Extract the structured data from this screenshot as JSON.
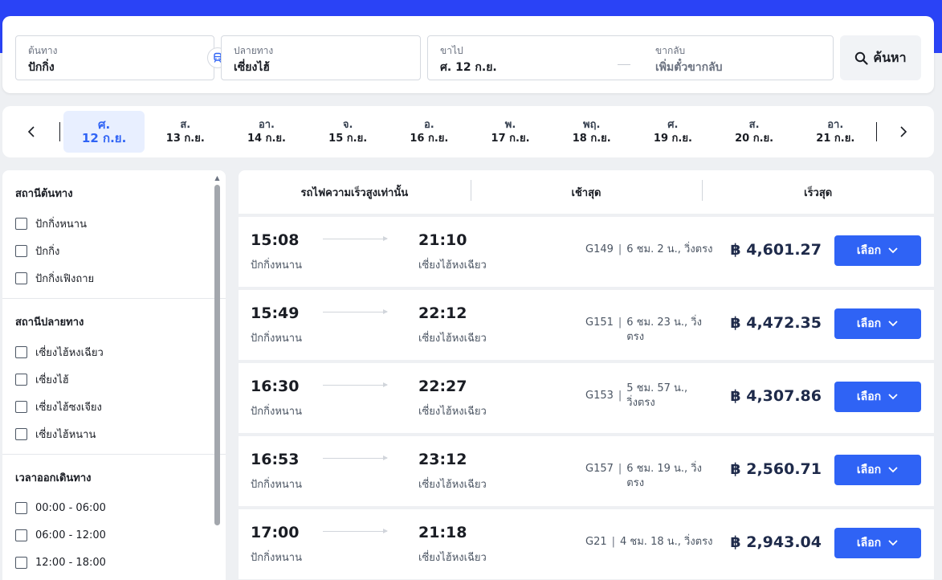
{
  "search": {
    "origin_label": "ต้นทาง",
    "origin_value": "ปักกิ่ง",
    "dest_label": "ปลายทาง",
    "dest_value": "เซี่ยงไฮ้",
    "depart_label": "ขาไป",
    "depart_value": "ศ. 12 ก.ย.",
    "return_label": "ขากลับ",
    "return_placeholder": "เพิ่มตั๋วขากลับ",
    "search_button": "ค้นหา",
    "swap_icon": "train-icon",
    "search_icon": "search-icon"
  },
  "dates": [
    {
      "dow": "ศ.",
      "dm": "12 ก.ย."
    },
    {
      "dow": "ส.",
      "dm": "13 ก.ย."
    },
    {
      "dow": "อา.",
      "dm": "14 ก.ย."
    },
    {
      "dow": "จ.",
      "dm": "15 ก.ย."
    },
    {
      "dow": "อ.",
      "dm": "16 ก.ย."
    },
    {
      "dow": "พ.",
      "dm": "17 ก.ย."
    },
    {
      "dow": "พฤ.",
      "dm": "18 ก.ย."
    },
    {
      "dow": "ศ.",
      "dm": "19 ก.ย."
    },
    {
      "dow": "ส.",
      "dm": "20 ก.ย."
    },
    {
      "dow": "อา.",
      "dm": "21 ก.ย."
    }
  ],
  "filters": {
    "origin_title": "สถานีต้นทาง",
    "origin_options": [
      "ปักกิ่งหนาน",
      "ปักกิ่ง",
      "ปักกิ่งเฟิงถาย"
    ],
    "dest_title": "สถานีปลายทาง",
    "dest_options": [
      "เซี่ยงไฮ้หงเฉียว",
      "เซี่ยงไฮ้",
      "เซี่ยงไฮ้ซงเจียง",
      "เซี่ยงไฮ้หนาน"
    ],
    "time_title": "เวลาออกเดินทาง",
    "time_options": [
      "00:00 - 06:00",
      "06:00 - 12:00",
      "12:00 - 18:00"
    ]
  },
  "tabs": [
    "รถไฟความเร็วสูงเท่านั้น",
    "เช้าสุด",
    "เร็วสุด"
  ],
  "results": [
    {
      "dep": "15:08",
      "dep_station": "ปักกิ่งหนาน",
      "arr": "21:10",
      "arr_station": "เซี่ยงไฮ้หงเฉียว",
      "train": "G149",
      "duration": "6 ชม. 2 น., วิ่งตรง",
      "price": "฿ 4,601.27",
      "button": "เลือก"
    },
    {
      "dep": "15:49",
      "dep_station": "ปักกิ่งหนาน",
      "arr": "22:12",
      "arr_station": "เซี่ยงไฮ้หงเฉียว",
      "train": "G151",
      "duration": "6 ชม. 23 น., วิ่งตรง",
      "price": "฿ 4,472.35",
      "button": "เลือก"
    },
    {
      "dep": "16:30",
      "dep_station": "ปักกิ่งหนาน",
      "arr": "22:27",
      "arr_station": "เซี่ยงไฮ้หงเฉียว",
      "train": "G153",
      "duration": "5 ชม. 57 น., วิ่งตรง",
      "price": "฿ 4,307.86",
      "button": "เลือก"
    },
    {
      "dep": "16:53",
      "dep_station": "ปักกิ่งหนาน",
      "arr": "23:12",
      "arr_station": "เซี่ยงไฮ้หงเฉียว",
      "train": "G157",
      "duration": "6 ชม. 19 น., วิ่งตรง",
      "price": "฿ 2,560.71",
      "button": "เลือก"
    },
    {
      "dep": "17:00",
      "dep_station": "ปักกิ่งหนาน",
      "arr": "21:18",
      "arr_station": "เซี่ยงไฮ้หงเฉียว",
      "train": "G21",
      "duration": "4 ชม. 18 น., วิ่งตรง",
      "price": "฿ 2,943.04",
      "button": "เลือก"
    }
  ],
  "colors": {
    "brand": "#2a43f6",
    "accent": "#2f63f5",
    "active_date_bg": "#e8efff"
  }
}
